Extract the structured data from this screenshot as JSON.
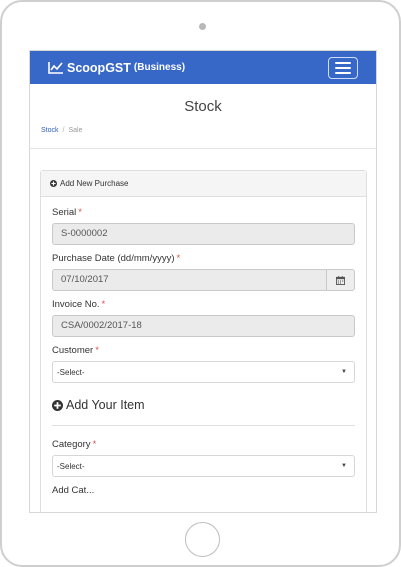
{
  "app": {
    "brand_name": "ScoopGST",
    "brand_edition": "(Business)"
  },
  "page": {
    "title": "Stock",
    "breadcrumb": [
      "Stock",
      "Sale"
    ],
    "breadcrumb_separator": "/"
  },
  "panel": {
    "heading": "Add New Purchase"
  },
  "form": {
    "serial": {
      "label": "Serial",
      "required_mark": "*",
      "value": "S-0000002"
    },
    "purchase_date": {
      "label": "Purchase Date (dd/mm/yyyy)",
      "required_mark": "*",
      "value": "07/10/2017"
    },
    "invoice_no": {
      "label": "Invoice No.",
      "required_mark": "*",
      "value": "CSA/0002/2017-18"
    },
    "customer": {
      "label": "Customer",
      "required_mark": "*",
      "selected": "-Select-"
    }
  },
  "item_section": {
    "title": "Add Your Item",
    "category": {
      "label": "Category",
      "required_mark": "*",
      "selected": "-Select-"
    },
    "next_label_partial": "Add Cat..."
  },
  "colors": {
    "navbar": "#3768c7",
    "required": "#d9534f",
    "link": "#2f5fb8"
  },
  "icons": {
    "brand": "line-chart-icon",
    "menu": "hamburger-icon",
    "panel_heading": "plus-circle-icon",
    "date": "calendar-icon",
    "section": "plus-circle-icon",
    "select": "caret-down-icon"
  }
}
